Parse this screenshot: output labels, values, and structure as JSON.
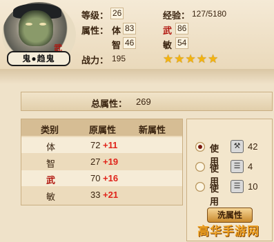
{
  "header": {
    "name": "鬼●趋鬼",
    "class_tag": "武",
    "level_label": "等级：",
    "level": "26",
    "exp_label": "经验：",
    "exp": "127/5180",
    "attr_label": "属性：",
    "attrs": {
      "ti_label": "体",
      "ti": "83",
      "wu_label": "武",
      "wu": "86",
      "zhi_label": "智",
      "zhi": "46",
      "min_label": "敏",
      "min": "54"
    },
    "power_label": "战力：",
    "power": "195",
    "stars": 5,
    "stars_text": "★★★★★"
  },
  "total": {
    "label": "总属性：",
    "value": "269"
  },
  "table": {
    "headers": [
      "类别",
      "原属性",
      "新属性"
    ],
    "rows": [
      {
        "cat": "体",
        "orig": "72",
        "plus": "+11"
      },
      {
        "cat": "智",
        "orig": "27",
        "plus": "+19"
      },
      {
        "cat": "武",
        "orig": "70",
        "plus": "+16"
      },
      {
        "cat": "敏",
        "orig": "33",
        "plus": "+21"
      }
    ]
  },
  "options": [
    {
      "label": "使用",
      "icon": "tool-icon",
      "count": "42",
      "selected": true
    },
    {
      "label": "使用",
      "icon": "scroll-icon",
      "count": "4",
      "selected": false
    },
    {
      "label": "使用",
      "icon": "scroll-icon",
      "count": "10",
      "selected": false
    }
  ],
  "button": {
    "label": "洗属性"
  },
  "watermark": "高华手游网"
}
